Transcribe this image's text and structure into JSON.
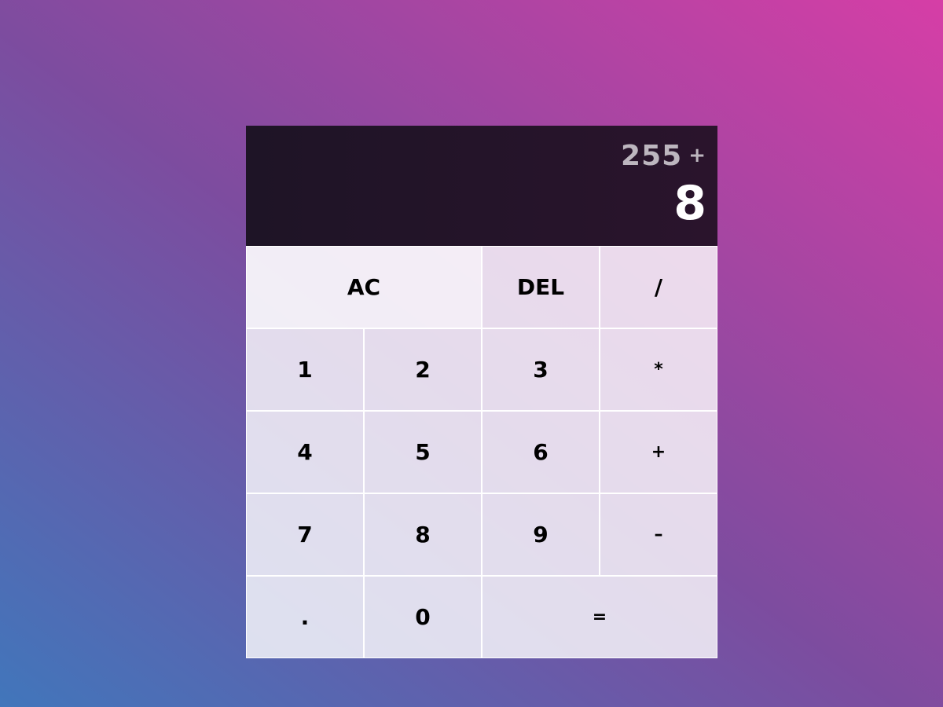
{
  "display": {
    "previous_operand": "255",
    "operation": "+",
    "current_operand": "8"
  },
  "keys": {
    "all_clear": "AC",
    "delete": "DEL",
    "divide": "/",
    "one": "1",
    "two": "2",
    "three": "3",
    "multiply": "*",
    "four": "4",
    "five": "5",
    "six": "6",
    "add": "+",
    "seven": "7",
    "eight": "8",
    "nine": "9",
    "subtract": "–",
    "decimal": ".",
    "zero": "0",
    "equals": "="
  }
}
